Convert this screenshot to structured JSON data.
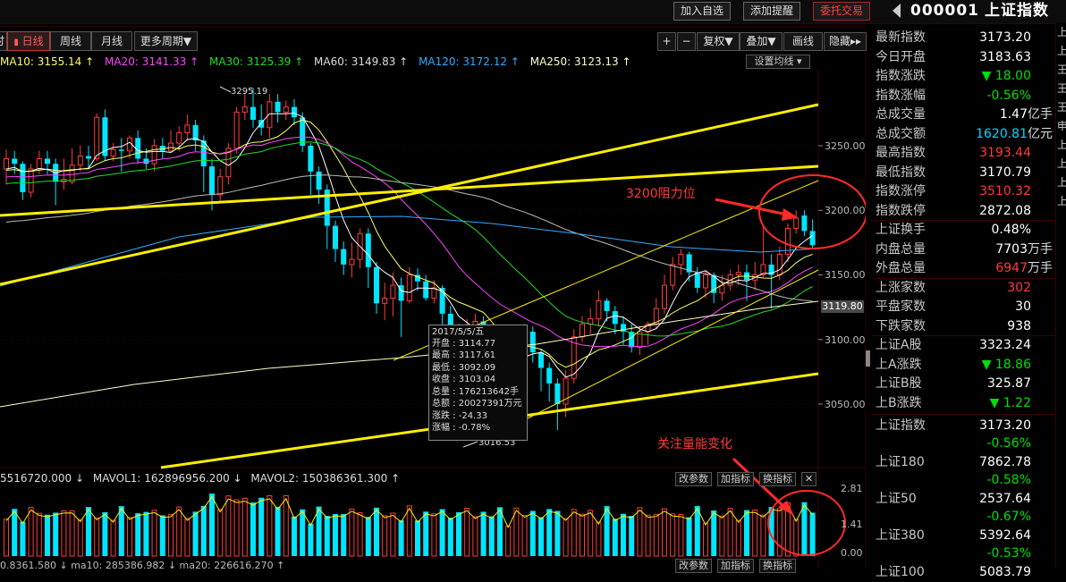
{
  "topbar": {
    "add_watch": "加入自选",
    "add_alert": "添加提醒",
    "trade": "委托交易",
    "code": "000001",
    "name": "上证指数"
  },
  "tabs": {
    "left_cut": "时",
    "daily": "日线",
    "weekly": "周线",
    "monthly": "月线",
    "more": "更多周期▼"
  },
  "tools": {
    "plus": "+",
    "minus": "−",
    "fq": "复权▼",
    "overlay": "叠加▼",
    "draw": "画线",
    "hide": "隐藏▸▸"
  },
  "ma_legend": {
    "ma10": "MA10: 3155.14 ↑",
    "ma20": "MA20: 3141.33 ↑",
    "ma30": "MA30: 3125.39 ↑",
    "ma60": "MA60: 3149.83 ↑",
    "ma120": "MA120: 3172.12 ↑",
    "ma250": "MA250: 3123.13 ↑",
    "settings": "设置均线 ▾"
  },
  "colors": {
    "up": "#ff3b3b",
    "down": "#00e5ff",
    "trend": "#ffee00",
    "ma5": "#ffffff",
    "ma10": "#ffff66",
    "ma20": "#ff44ff",
    "ma30": "#22dd22",
    "ma60": "#bbbbbb",
    "ma120": "#33aaff",
    "ma250": "#ffffcc"
  },
  "price_axis": {
    "labels": [
      "3250.00",
      "3200.00",
      "3150.00",
      "3100.00",
      "3050.00"
    ],
    "current": "3119.80",
    "high_marker": "3295.19",
    "low_marker": "3016.53"
  },
  "tooltip": {
    "date": "2017/5/5/五",
    "open": "开盘 : 3114.77",
    "high": "最高 : 3117.61",
    "low": "最低 : 3092.09",
    "close": "收盘 : 3103.04",
    "volume": "总量 : 176213642手",
    "amount": "总额 : 20027391万元",
    "change": "涨跌 : -24.33",
    "pct": "涨幅 : -0.78%"
  },
  "annotations": {
    "resistance": "3200阻力位",
    "volume_note": "关注量能变化"
  },
  "volume_legend": {
    "vol": "5516720.000 ↓",
    "mavol1": "MAVOL1: 162896956.200 ↓",
    "mavol2": "MAVOL2: 150386361.300 ↑",
    "btn_params": "改参数",
    "btn_add": "加指标",
    "btn_switch": "换指标",
    "btn_close": "✕",
    "axis": [
      "2.81",
      "1.41",
      "0.00"
    ],
    "bottom": "0.8361.580 ↓  ma10: 285386.982 ↓  ma20: 226616.270 ↑"
  },
  "quote": {
    "rows": [
      {
        "k": "最新指数",
        "v": "3173.20",
        "c": "white"
      },
      {
        "k": "今日开盘",
        "v": "3183.63",
        "c": "white"
      },
      {
        "k": "指数涨跌",
        "v": "▼ 18.00",
        "c": "green"
      },
      {
        "k": "指数涨幅",
        "v": "-0.56%",
        "c": "green"
      },
      {
        "k": "总成交量",
        "v": "1.47",
        "u": "亿手",
        "c": "white"
      },
      {
        "k": "总成交额",
        "v": "1620.81",
        "u": "亿元",
        "c": "cyan"
      },
      {
        "k": "最高指数",
        "v": "3193.44",
        "c": "red"
      },
      {
        "k": "最低指数",
        "v": "3170.79",
        "c": "white"
      },
      {
        "k": "指数涨停",
        "v": "3510.32",
        "c": "red"
      },
      {
        "k": "指数跌停",
        "v": "2872.08",
        "c": "white"
      },
      {
        "k": "上证换手",
        "v": "0.48%",
        "c": "white"
      },
      {
        "k": "内盘总量",
        "v": "7703",
        "u": "万手",
        "c": "white"
      },
      {
        "k": "外盘总量",
        "v": "6947",
        "u": "万手",
        "c": "red"
      },
      {
        "k": "上涨家数",
        "v": "302",
        "c": "red"
      },
      {
        "k": "平盘家数",
        "v": "30",
        "c": "white"
      },
      {
        "k": "下跌家数",
        "v": "938",
        "c": "white"
      },
      {
        "k": "上证A股",
        "v": "3323.24",
        "c": "white"
      },
      {
        "k": "上A涨跌",
        "v": "▼ 18.86",
        "c": "green"
      },
      {
        "k": "上证B股",
        "v": "325.87",
        "c": "white"
      },
      {
        "k": "上B涨跌",
        "v": "▼ 1.22",
        "c": "green"
      }
    ],
    "indices": [
      {
        "k": "上证指数",
        "v": "3173.20",
        "p": "-0.56%"
      },
      {
        "k": "上证180",
        "v": "7862.78",
        "p": "-0.58%"
      },
      {
        "k": "上证50",
        "v": "2537.64",
        "p": "-0.67%"
      },
      {
        "k": "上证380",
        "v": "5392.64",
        "p": "-0.53%"
      },
      {
        "k": "上证100",
        "v": "5083.79",
        "p": ""
      }
    ]
  }
}
